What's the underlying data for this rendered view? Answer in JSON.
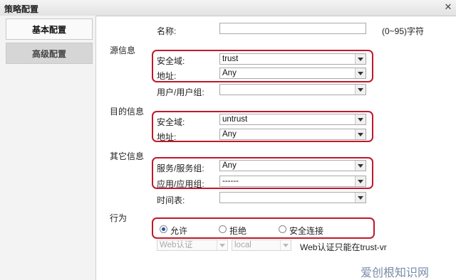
{
  "window": {
    "title": "策略配置",
    "close_glyph": "✕"
  },
  "nav": {
    "basic": "基本配置",
    "advanced": "高级配置"
  },
  "name": {
    "label": "名称:",
    "hint": "(0~95)字符",
    "value": ""
  },
  "source": {
    "heading": "源信息",
    "zone_label": "安全域:",
    "zone_value": "trust",
    "addr_label": "地址:",
    "addr_value": "Any",
    "user_label": "用户/用户组:",
    "user_value": ""
  },
  "dest": {
    "heading": "目的信息",
    "zone_label": "安全域:",
    "zone_value": "untrust",
    "addr_label": "地址:",
    "addr_value": "Any"
  },
  "other": {
    "heading": "其它信息",
    "service_label": "服务/服务组:",
    "service_value": "Any",
    "app_label": "应用/应用组:",
    "app_value": "------",
    "time_label": "时间表:",
    "time_value": ""
  },
  "action": {
    "heading": "行为",
    "allow": "允许",
    "deny": "拒绝",
    "secure": "安全连接",
    "selected": "allow"
  },
  "webauth": {
    "select1": "Web认证",
    "select2": "local",
    "note": "Web认证只能在trust-vr"
  },
  "watermark": "爱创根知识网",
  "colors": {
    "highlight": "#c0182a",
    "radio_dot": "#1f4fa8"
  }
}
